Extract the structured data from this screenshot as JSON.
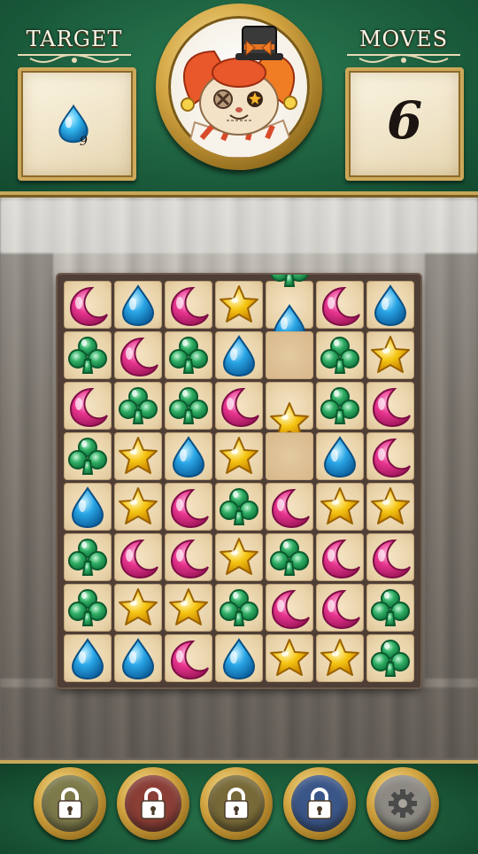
{
  "hud": {
    "target_title": "TARGET",
    "moves_title": "MOVES",
    "target": {
      "gem": "blue-drop",
      "count": "9"
    },
    "moves": "6",
    "portrait": "jester-hamster-portrait"
  },
  "board": {
    "cols": 7,
    "rows": 8,
    "cells": [
      [
        "pink-moon",
        "blue-drop",
        "pink-moon",
        "yellow-star",
        "blue-drop",
        "pink-moon",
        "blue-drop"
      ],
      [
        "green-club",
        "pink-moon",
        "green-club",
        "blue-drop",
        "empty",
        "green-club",
        "yellow-star"
      ],
      [
        "pink-moon",
        "green-club",
        "green-club",
        "pink-moon",
        "yellow-star",
        "green-club",
        "pink-moon"
      ],
      [
        "green-club",
        "yellow-star",
        "blue-drop",
        "yellow-star",
        "empty",
        "blue-drop",
        "pink-moon"
      ],
      [
        "blue-drop",
        "yellow-star",
        "pink-moon",
        "green-club",
        "pink-moon",
        "yellow-star",
        "yellow-star"
      ],
      [
        "green-club",
        "pink-moon",
        "pink-moon",
        "yellow-star",
        "green-club",
        "pink-moon",
        "pink-moon"
      ],
      [
        "green-club",
        "yellow-star",
        "yellow-star",
        "green-club",
        "pink-moon",
        "pink-moon",
        "green-club"
      ],
      [
        "blue-drop",
        "blue-drop",
        "pink-moon",
        "blue-drop",
        "yellow-star",
        "yellow-star",
        "green-club"
      ]
    ],
    "falling_top": "green-club",
    "colors": {
      "pink-moon": "#e8358f",
      "blue-drop": "#2aa6e6",
      "yellow-star": "#f6c613",
      "green-club": "#2fae64"
    }
  },
  "boosters": [
    {
      "name": "booster-1-locked",
      "icon": "lock-icon",
      "color": "#7c7a4a"
    },
    {
      "name": "booster-2-locked",
      "icon": "lock-icon",
      "color": "#8a3e36"
    },
    {
      "name": "booster-3-locked",
      "icon": "lock-icon",
      "color": "#786a38"
    },
    {
      "name": "booster-4-locked",
      "icon": "lock-icon",
      "color": "#3a5688"
    },
    {
      "name": "settings",
      "icon": "gear-icon",
      "color": "#8d8a84"
    }
  ]
}
